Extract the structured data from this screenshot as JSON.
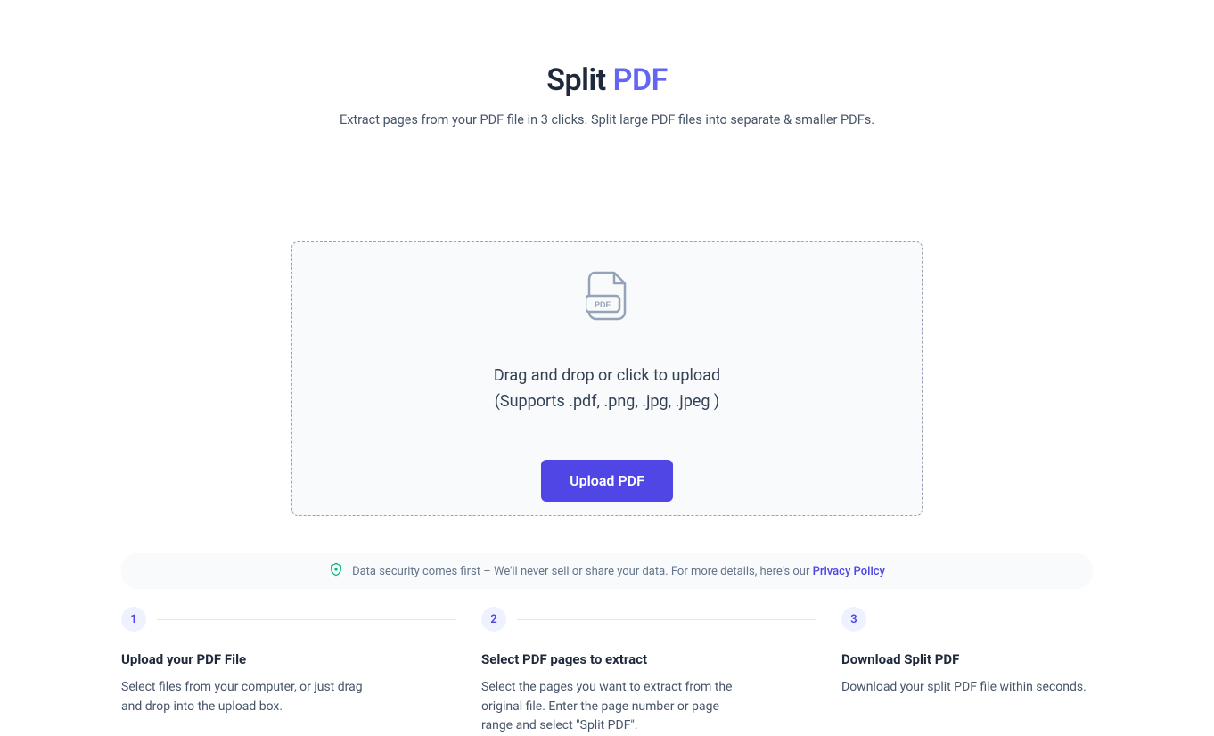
{
  "header": {
    "title_prefix": "Split",
    "title_accent": "PDF",
    "subtitle": "Extract pages from your PDF file in 3 clicks. Split large PDF files into separate & smaller PDFs."
  },
  "dropzone": {
    "line1": "Drag and drop or click to upload",
    "line2": "(Supports .pdf, .png, .jpg, .jpeg )",
    "button_label": "Upload PDF"
  },
  "security": {
    "text": "Data security comes first – We'll never sell or share your data. For more details, here's our ",
    "link_label": "Privacy Policy"
  },
  "steps": [
    {
      "number": "1",
      "title": "Upload your PDF File",
      "description": "Select files from your computer, or just drag and drop into the upload box."
    },
    {
      "number": "2",
      "title": "Select PDF pages to extract",
      "description": "Select the pages you want to extract from the original file. Enter the page number or page range and select \"Split PDF\"."
    },
    {
      "number": "3",
      "title": "Download Split PDF",
      "description": "Download your split PDF file within seconds."
    }
  ]
}
